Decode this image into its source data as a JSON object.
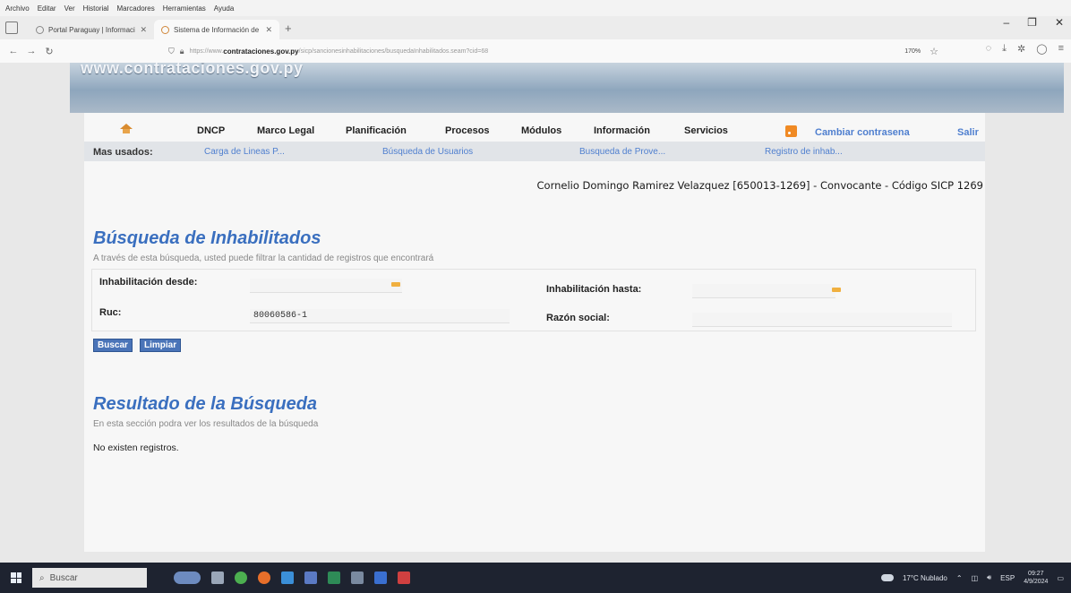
{
  "browser": {
    "menu": [
      "Archivo",
      "Editar",
      "Ver",
      "Historial",
      "Marcadores",
      "Herramientas",
      "Ayuda"
    ],
    "tabs": [
      {
        "label": "Portal Paraguay | Información",
        "active": false
      },
      {
        "label": "Sistema de Información de las",
        "active": true
      }
    ],
    "url": {
      "prefix": "https://www.",
      "domain": "contrataciones.gov.py",
      "path": "/sicp/sancionesinhabilitaciones/busquedaInhabilitados.seam?cid=68",
      "zoom": "170%"
    }
  },
  "banner": {
    "site": "www.contrataciones.gov.py"
  },
  "nav": {
    "items": [
      "DNCP",
      "Marco Legal",
      "Planificación",
      "Procesos",
      "Módulos",
      "Información",
      "Servicios"
    ],
    "change_password": "Cambiar contrasena",
    "logout": "Salir"
  },
  "most_used": {
    "label": "Mas usados:",
    "links": [
      "Carga de Lineas P...",
      "Búsqueda de Usuarios",
      "Busqueda de Prove...",
      "Registro de inhab..."
    ]
  },
  "user_line": "Cornelio Domingo Ramirez Velazquez [650013-1269] - Convocante - Código SICP 1269",
  "search": {
    "title": "Búsqueda de Inhabilitados",
    "subtitle": "A través de esta búsqueda, usted puede filtrar la cantidad de registros que encontrará",
    "fields": {
      "desde_label": "Inhabilitación desde:",
      "desde_value": "",
      "hasta_label": "Inhabilitación hasta:",
      "hasta_value": "",
      "ruc_label": "Ruc:",
      "ruc_value": "80060586-1",
      "razon_label": "Razón social:",
      "razon_value": ""
    },
    "buttons": {
      "search": "Buscar",
      "clear": "Limpiar"
    }
  },
  "results": {
    "title": "Resultado de la Búsqueda",
    "subtitle": "En esta sección podra ver los resultados de la búsqueda",
    "empty_text": "No existen registros."
  },
  "taskbar": {
    "search_placeholder": "Buscar",
    "weather": "17°C Nublado",
    "lang": "ESP",
    "time": "09:27",
    "date": "4/9/2024"
  }
}
